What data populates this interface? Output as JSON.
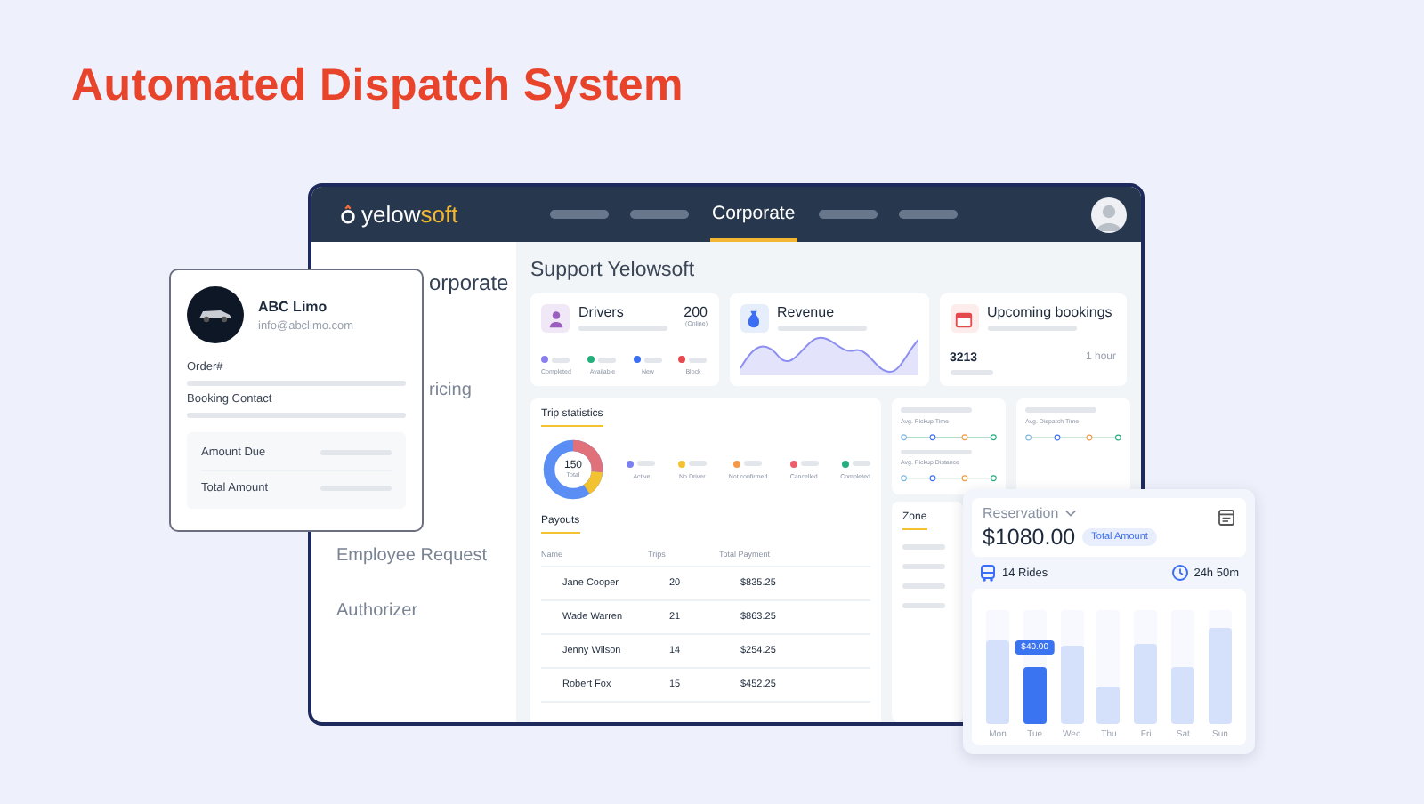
{
  "page_title": "Automated Dispatch System",
  "header": {
    "logo_text": "yelow",
    "logo_accent": "soft",
    "nav": [
      {
        "kind": "placeholder",
        "selected": false
      },
      {
        "kind": "placeholder",
        "selected": false
      },
      {
        "kind": "label",
        "label": "Corporate",
        "selected": true
      },
      {
        "kind": "placeholder",
        "selected": false
      },
      {
        "kind": "placeholder",
        "selected": false
      }
    ]
  },
  "sidebar": {
    "items": [
      {
        "label": "orporate",
        "selected": true
      },
      {
        "label": "ricing",
        "selected": false
      },
      {
        "label": "Employee Request",
        "selected": false
      },
      {
        "label": "Authorizer",
        "selected": false
      }
    ]
  },
  "customer_card": {
    "company": "ABC Limo",
    "email": "info@abclimo.com",
    "fields": [
      "Order#",
      "Booking Contact"
    ],
    "amounts": [
      "Amount Due",
      "Total Amount"
    ]
  },
  "content_title": "Support Yelowsoft",
  "drivers": {
    "title": "Drivers",
    "count": "200",
    "count_label": "(Online)",
    "legend": [
      {
        "label": "Completed",
        "color": "#8b7ff0"
      },
      {
        "label": "Available",
        "color": "#22b07d"
      },
      {
        "label": "New",
        "color": "#3b6ef5"
      },
      {
        "label": "Block",
        "color": "#e5484d"
      }
    ]
  },
  "revenue": {
    "title": "Revenue"
  },
  "upcoming": {
    "title": "Upcoming bookings",
    "count": "3213",
    "time": "1 hour"
  },
  "trip_statistics": {
    "title": "Trip statistics",
    "total": "150",
    "total_label": "Total",
    "legend": [
      {
        "label": "Active",
        "color": "#7b7ff0"
      },
      {
        "label": "No Driver",
        "color": "#f2c230"
      },
      {
        "label": "Not confirmed",
        "color": "#f2994a"
      },
      {
        "label": "Cancelled",
        "color": "#eb5f6a"
      },
      {
        "label": "Completed",
        "color": "#27ae80"
      }
    ]
  },
  "payouts": {
    "title": "Payouts",
    "columns": [
      "Name",
      "Trips",
      "Total Payment"
    ],
    "rows": [
      [
        "Jane Cooper",
        "20",
        "$835.25"
      ],
      [
        "Wade Warren",
        "21",
        "$863.25"
      ],
      [
        "Jenny Wilson",
        "14",
        "$254.25"
      ],
      [
        "Robert Fox",
        "15",
        "$452.25"
      ]
    ]
  },
  "metrics": [
    {
      "labels": [
        "Avg. Pickup Time",
        "Avg. Pickup Distance"
      ]
    },
    {
      "labels": [
        "Avg. Dispatch Time"
      ]
    }
  ],
  "zone": {
    "title": "Zone"
  },
  "reservation": {
    "label": "Reservation",
    "amount": "$1080.00",
    "badge": "Total Amount",
    "rides": "14 Rides",
    "duration": "24h 50m",
    "tooltip": "$40.00",
    "days": [
      {
        "label": "Mon",
        "level": 0.74,
        "selected": false
      },
      {
        "label": "Tue",
        "level": 0.5,
        "selected": true
      },
      {
        "label": "Wed",
        "level": 0.68,
        "selected": false
      },
      {
        "label": "Thu",
        "level": 0.33,
        "selected": false
      },
      {
        "label": "Fri",
        "level": 0.71,
        "selected": false
      },
      {
        "label": "Sat",
        "level": 0.5,
        "selected": false
      },
      {
        "label": "Sun",
        "level": 0.84,
        "selected": false
      }
    ]
  }
}
